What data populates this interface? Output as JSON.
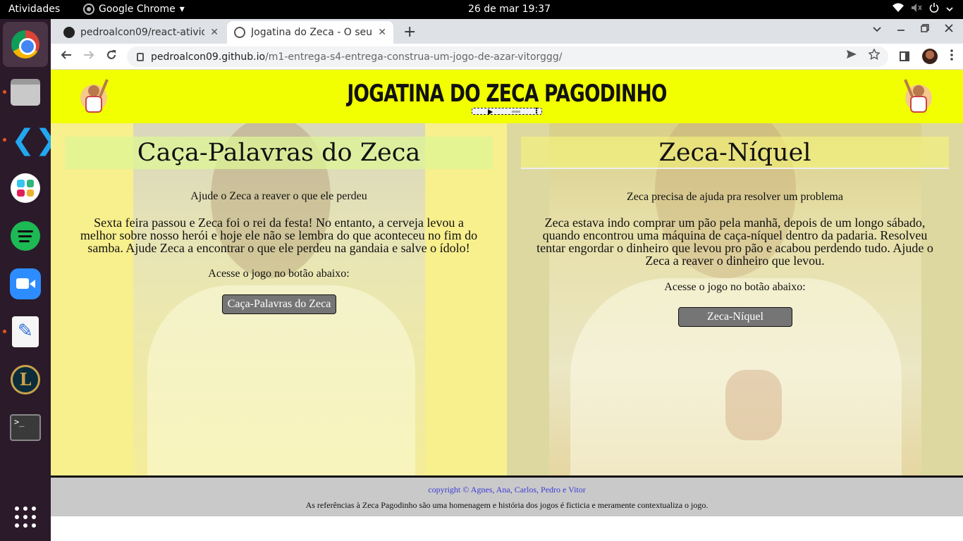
{
  "system_bar": {
    "activities": "Atividades",
    "app_name": "Google Chrome",
    "app_menu_arrow": "▾",
    "datetime": "26 de mar  19:37"
  },
  "dock": {
    "apps": [
      "chrome-icon",
      "files-icon",
      "vscode-icon",
      "slack-icon",
      "spotify-icon",
      "zoom-icon",
      "text-editor-icon",
      "league-of-legends-icon",
      "terminal-icon",
      "show-apps-icon"
    ],
    "terminal_glyph": ">_",
    "lol_glyph": "L",
    "vscode_glyph": "❮❯"
  },
  "browser": {
    "tabs": [
      {
        "title": "pedroalcon09/react-ativid",
        "favicon": "github-icon"
      },
      {
        "title": "Jogatina do Zeca - O seu s",
        "favicon": "globe-icon"
      }
    ],
    "tab_close": "✕",
    "new_tab": "+",
    "url_host": "pedroalcon09.github.io",
    "url_path": "/m1-entrega-s4-entrega-construa-um-jogo-de-azar-vitorggg/"
  },
  "page": {
    "site_title": "JOGATINA DO ZECA PAGODINHO",
    "games": [
      {
        "title": "Caça-Palavras do Zeca",
        "subtitle": "Ajude o Zeca a reaver o que ele perdeu",
        "story": "Sexta feira passou e Zeca foi o rei da festa! No entanto, a cerveja levou a melhor sobre nosso herói e hoje ele não se lembra do que aconteceu no fim do samba. Ajude Zeca a encontrar o que ele perdeu na gandaia e salve o ídolo!",
        "access": "Acesse o jogo no botão abaixo:",
        "button": "Caça-Palavras do Zeca"
      },
      {
        "title": "Zeca-Níquel",
        "subtitle": "Zeca precisa de ajuda pra resolver um problema",
        "story": "Zeca estava indo comprar um pão pela manhã, depois de um longo sábado, quando encontrou uma máquina de caça-níquel dentro da padaria. Resolveu tentar engordar o dinheiro que levou pro pão e acabou perdendo tudo. Ajude o Zeca a reaver o dinheiro que levou.",
        "access": "Acesse o jogo no botão abaixo:",
        "button": "Zeca-Níquel"
      }
    ],
    "footer": {
      "copyright": "copyright © Agnes, Ana, Carlos, Pedro e Vitor",
      "note": "As referências à Zeca Pagodinho são uma homenagem e história dos jogos é ficticia e meramente contextualiza o jogo."
    }
  },
  "colors": {
    "header_yellow": "#f2ff00",
    "left_panel": "#f8ef8d",
    "right_panel": "#ddd8a0",
    "button_gray": "#757575",
    "footer_link": "#3b3bd9"
  }
}
